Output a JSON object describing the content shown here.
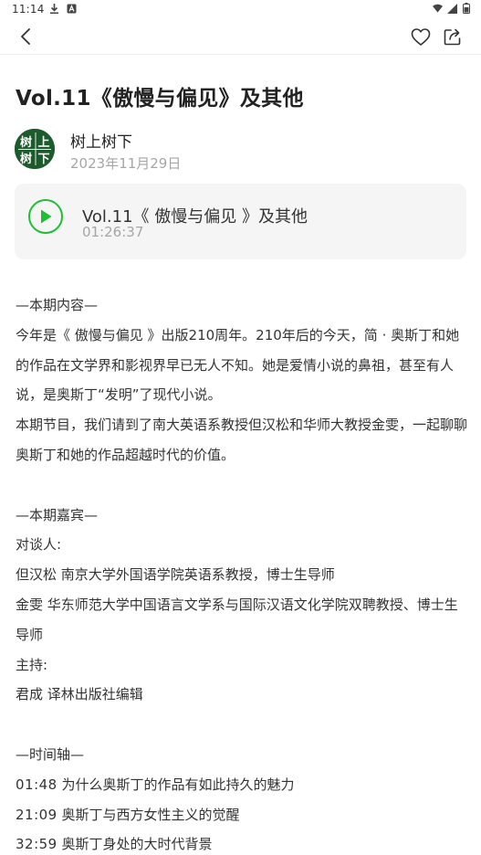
{
  "status_bar": {
    "time": "11:14",
    "icons": [
      "download-icon",
      "a-notification-icon",
      "wifi-icon",
      "signal-icon",
      "battery-icon"
    ]
  },
  "nav": {
    "icons": [
      "back-arrow-icon",
      "heart-icon",
      "share-icon"
    ]
  },
  "episode": {
    "title": "Vol.11《傲慢与偏见》及其他"
  },
  "author": {
    "name": "树上树下",
    "date": "2023年11月29日",
    "avatar_text": [
      "树",
      "上",
      "树",
      "下"
    ]
  },
  "player": {
    "title": "Vol.11《 傲慢与偏见 》及其他",
    "duration": "01:26:37",
    "accent_color": "#1fbf33"
  },
  "content": {
    "section_contents": "—本期内容—",
    "intro_p1": "今年是《 傲慢与偏见 》出版210周年。210年后的今天，简 · 奥斯丁和她的作品在文学界和影视界早已无人不知。她是爱情小说的鼻祖，甚至有人说，是奥斯丁“发明”了现代小说。",
    "intro_p2": "本期节目，我们请到了南大英语系教授但汉松和华师大教授金雯，一起聊聊奥斯丁和她的作品超越时代的价值。",
    "section_guests": "—本期嘉宾—",
    "guests_label": "对谈人:",
    "guest_1": "但汉松 南京大学外国语学院英语系教授，博士生导师",
    "guest_2": "金雯 华东师范大学中国语言文学系与国际汉语文化学院双聘教授、博士生导师",
    "host_label": "主持:",
    "host": "君成 译林出版社编辑",
    "section_timeline": "—时间轴—",
    "timeline": [
      {
        "time": "01:48",
        "text": "为什么奥斯丁的作品有如此持久的魅力"
      },
      {
        "time": "21:09",
        "text": "奥斯丁与西方女性主义的觉醒"
      },
      {
        "time": "32:59",
        "text": "奥斯丁身处的大时代背景"
      }
    ]
  }
}
